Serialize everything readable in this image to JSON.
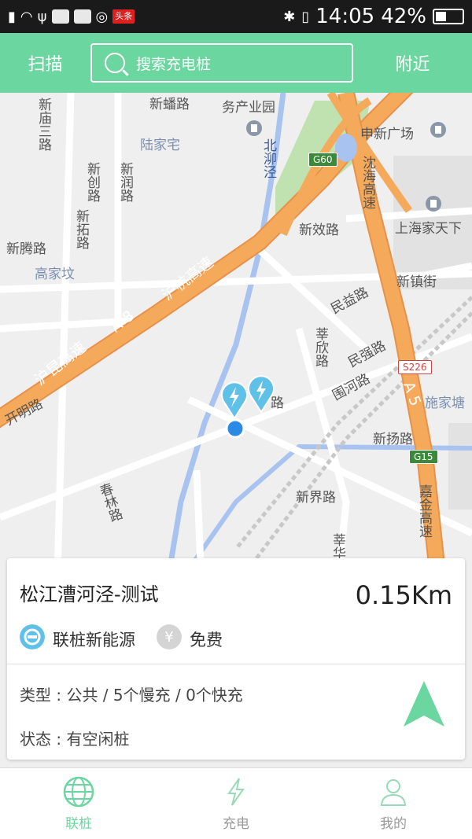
{
  "status_bar": {
    "time": "14:05",
    "battery": "42%",
    "battery_level": 0.42,
    "badge": "头条"
  },
  "header": {
    "scan_label": "扫描",
    "search_placeholder": "搜索充电桩",
    "nearby_label": "附近"
  },
  "map": {
    "labels": {
      "xinfan_rd": "新蟠路",
      "wuchanye": "务产业园",
      "shenxin_plaza": "申新广场",
      "xinmiao3": "新庙三路",
      "lujiazhai": "陆家宅",
      "xinchuang": "新创路",
      "xinrun": "新润路",
      "xintuo": "新拓路",
      "beihejing": "北泖泾",
      "shenhai_expwy": "沈海高速",
      "xinxiao_rd": "新效路",
      "shanghai_home": "上海家天下",
      "xinteng_rd": "新腾路",
      "gaojiatai": "高家坟",
      "xinzhen_st": "新镇街",
      "huhang_expwy": "沪杭高速",
      "a8": "A 8",
      "hukun_expwy": "沪昆高速",
      "minyi_rd": "民益路",
      "xinxin_rd": "莘欣路",
      "minqiang_rd": "民强路",
      "weihe_rd": "围河路",
      "kaiming_rd": "开明路",
      "shijiatang": "施家塘",
      "a5": "A 5",
      "xinyang_rd": "新扬路",
      "chunlin_rd": "春林路",
      "xinjie_rd": "新界路",
      "jiajin_expwy": "嘉金高速",
      "xinhua": "莘华",
      "road_fragment": "路"
    },
    "shields": {
      "g60": "G60",
      "s226": "S226",
      "g15": "G15"
    }
  },
  "station_card": {
    "name": "松江漕河泾-测试",
    "distance": "0.15Km",
    "operator": "联桩新能源",
    "fee": "免费",
    "type_label": "类型",
    "type_value": "公共 / 5个慢充 / 0个快充",
    "status_label": "状态",
    "status_value": "有空闲桩"
  },
  "tabs": [
    {
      "label": "联桩",
      "icon": "globe-icon",
      "active": true
    },
    {
      "label": "充电",
      "icon": "lightning-icon",
      "active": false
    },
    {
      "label": "我的",
      "icon": "user-icon",
      "active": false
    }
  ],
  "colors": {
    "accent": "#6bd6a0",
    "highway": "#f5a95a",
    "river": "#a9c3f0",
    "pin": "#5fc0e8",
    "location": "#2a8ae6"
  }
}
